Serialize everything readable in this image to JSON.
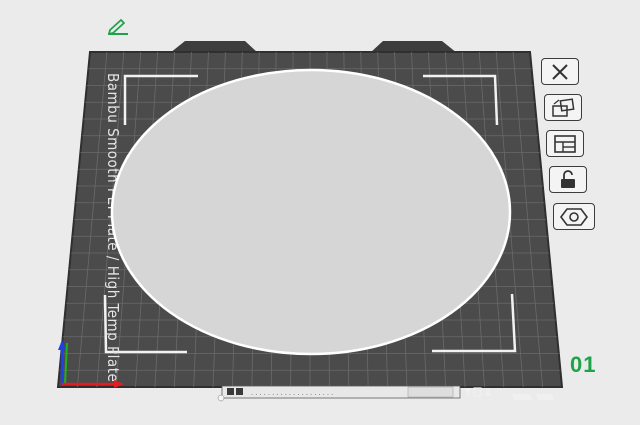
{
  "plate": {
    "label": "Bambu Smooth PEI Plate / High Temp Plate",
    "number": "01",
    "bottom_strip_text": "...................."
  },
  "toolbar": {
    "buttons": [
      {
        "name": "delete-plate-button",
        "icon": "close-icon"
      },
      {
        "name": "arrange-button",
        "icon": "arrange-icon"
      },
      {
        "name": "plate-settings-button",
        "icon": "layout-icon"
      },
      {
        "name": "lock-button",
        "icon": "lock-icon"
      },
      {
        "name": "plate-type-button",
        "icon": "hex-nut-icon"
      }
    ]
  },
  "colors": {
    "plate_dark": "#4b4b4b",
    "grid": "#6c6c6c",
    "accent_green": "#1fa34a",
    "axis_x": "#e02020",
    "axis_y": "#20b020",
    "axis_z": "#2040e0"
  }
}
